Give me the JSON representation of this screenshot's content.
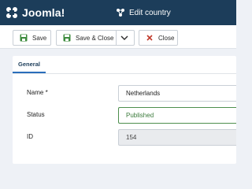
{
  "brand": {
    "name": "Joomla!"
  },
  "header": {
    "title": "Edit country"
  },
  "toolbar": {
    "save_label": "Save",
    "save_close_label": "Save & Close",
    "close_label": "Close"
  },
  "tabs": [
    {
      "label": "General",
      "active": true
    }
  ],
  "form": {
    "name_label": "Name *",
    "name_value": "Netherlands",
    "status_label": "Status",
    "status_value": "Published",
    "id_label": "ID",
    "id_value": "154"
  },
  "colors": {
    "header_bg": "#1c3d5a",
    "accent": "#2a6ebb",
    "save_green": "#3d8b3d",
    "close_red": "#c0392b",
    "status_green": "#4d8f4d"
  },
  "icons": {
    "brand": "joomla-logo-icon",
    "title": "edit-country-icon",
    "save": "save-icon",
    "save_close": "save-close-icon",
    "caret": "chevron-down-icon",
    "close": "close-icon"
  }
}
